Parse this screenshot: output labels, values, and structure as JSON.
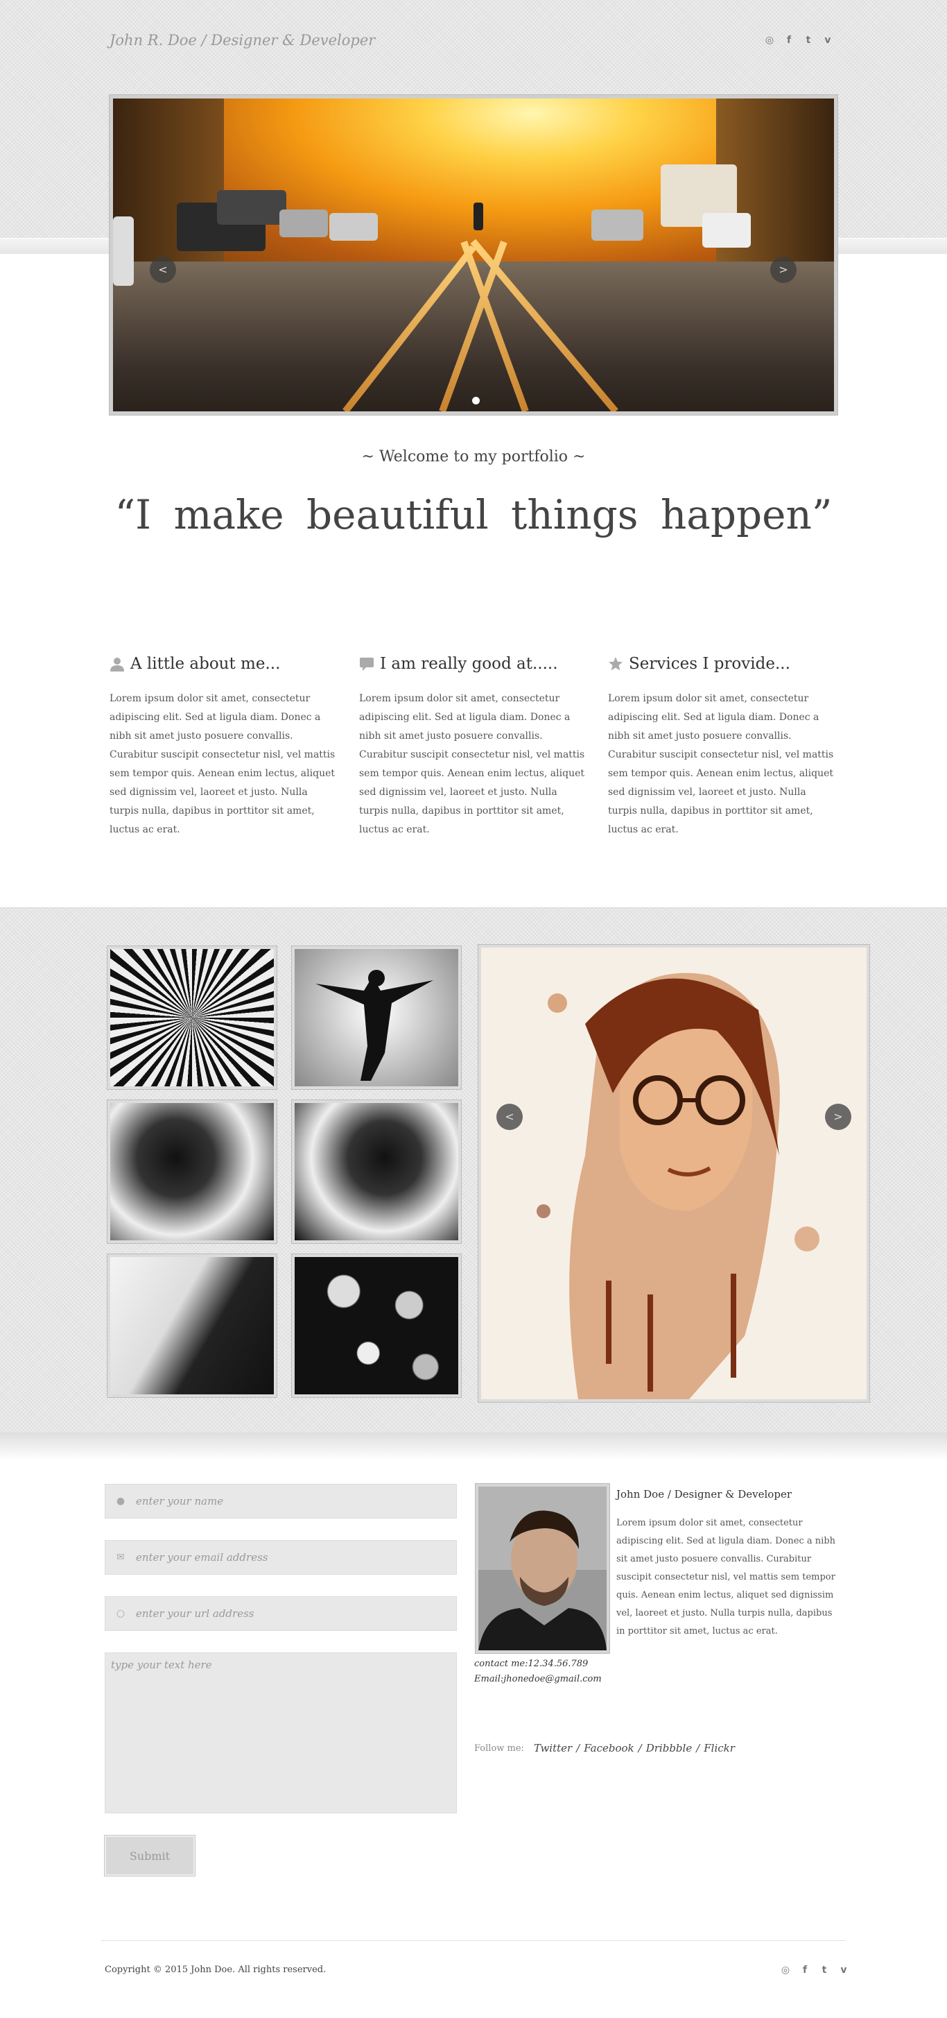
{
  "header": {
    "site_title": "John R. Doe / Designer & Developer",
    "social_icons": [
      "dribbble-icon",
      "facebook-icon",
      "twitter-icon",
      "vimeo-icon"
    ]
  },
  "slider": {
    "prev_label": "<",
    "next_label": ">",
    "active_dot": 1,
    "dot_count": 1
  },
  "intro": {
    "welcome": "~ Welcome to my portfolio ~",
    "tagline": "“I  make  beautiful  things  happen”"
  },
  "columns": [
    {
      "icon": "user-icon",
      "title": "A little about me...",
      "text": "Lorem ipsum dolor sit amet, consectetur adipiscing elit. Sed at ligula diam. Donec a nibh sit amet justo posuere convallis. Curabitur suscipit consectetur nisl, vel mattis sem tempor quis. Aenean enim lectus, aliquet sed dignissim vel, laoreet et justo. Nulla turpis nulla, dapibus in porttitor sit amet, luctus ac erat."
    },
    {
      "icon": "speech-bubble-icon",
      "title": "I am really good at.....",
      "text": "Lorem ipsum dolor sit amet, consectetur adipiscing elit. Sed at ligula diam. Donec a nibh sit amet justo posuere convallis. Curabitur suscipit consectetur nisl, vel mattis sem tempor quis. Aenean enim lectus, aliquet sed dignissim vel, laoreet et justo. Nulla turpis nulla, dapibus in porttitor sit amet, luctus ac erat."
    },
    {
      "icon": "star-icon",
      "title": "Services I provide...",
      "text": "Lorem ipsum dolor sit amet, consectetur adipiscing elit. Sed at ligula diam. Donec a nibh sit amet justo posuere convallis. Curabitur suscipit consectetur nisl, vel mattis sem tempor quis. Aenean enim lectus, aliquet sed dignissim vel, laoreet et justo. Nulla turpis nulla, dapibus in porttitor sit amet, luctus ac erat."
    }
  ],
  "gallery": {
    "prev_label": "<",
    "next_label": ">"
  },
  "contact_form": {
    "name_placeholder": "enter your name",
    "email_placeholder": "enter your email address",
    "url_placeholder": "enter your url address",
    "message_placeholder": "type your text here",
    "submit_label": "Submit"
  },
  "profile": {
    "name": "John Doe / Designer & Developer",
    "bio": "Lorem ipsum dolor sit amet, consectetur adipiscing elit. Sed at ligula diam. Donec a nibh sit amet justo posuere convallis. Curabitur suscipit consectetur nisl, vel mattis sem tempor quis. Aenean enim lectus, aliquet sed dignissim vel, laoreet et justo. Nulla turpis nulla, dapibus in porttitor sit amet, luctus ac erat.",
    "contact": "contact me:12.34.56.789",
    "email": "Email:jhonedoe@gmail.com",
    "follow_label": "Follow me:",
    "links": [
      "Twitter",
      "Facebook",
      "Dribbble",
      "Flickr"
    ],
    "separator": "/"
  },
  "footer": {
    "copyright": "Copyright © 2015 John Doe. All rights reserved."
  },
  "colors": {
    "accent_text": "#999999",
    "body_text": "#333333",
    "band_background": "#e6e6e6"
  }
}
